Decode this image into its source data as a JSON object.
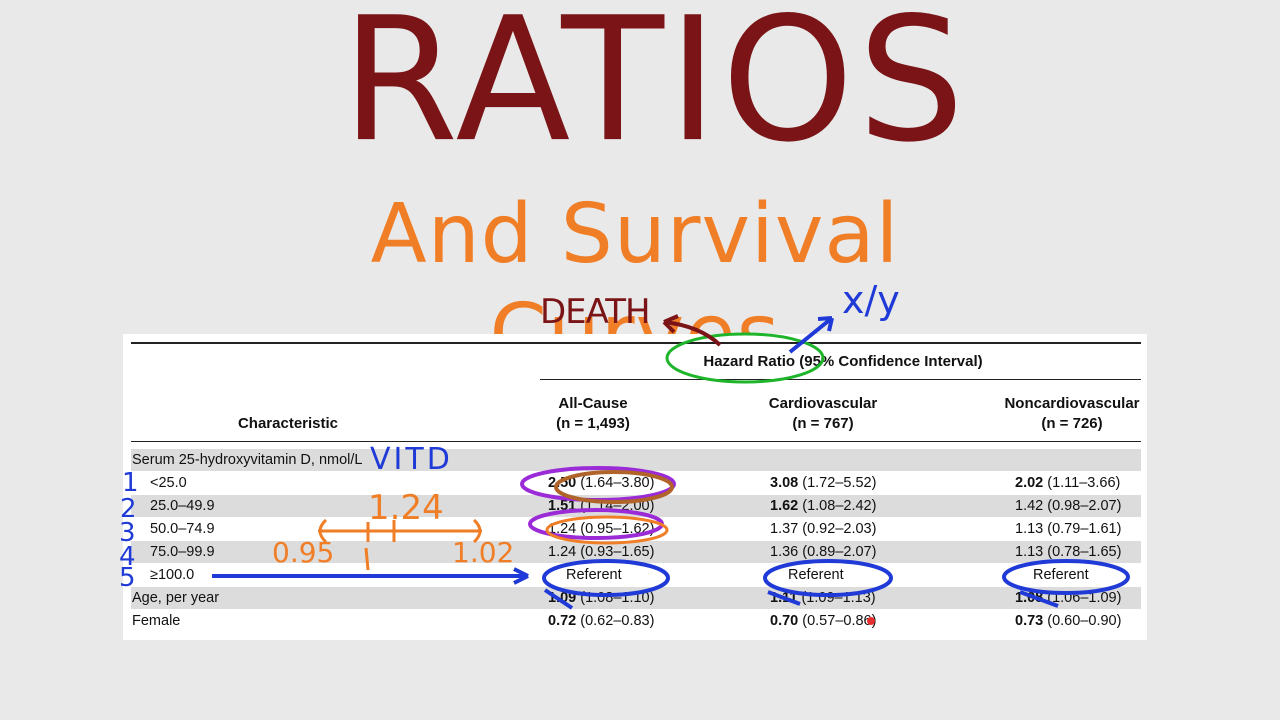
{
  "slide": {
    "title": "RATIOS",
    "subtitle": "And Survival Curves"
  },
  "annotations": {
    "death": "DEATH",
    "xy": "x/y",
    "vitd": "VITD",
    "hr_value": "1.24",
    "ci_low": "0.95",
    "ci_one": "1",
    "ci_high": "1.02",
    "row_numbers": [
      "1",
      "2",
      "3",
      "4",
      "5"
    ]
  },
  "table": {
    "group_header": "Hazard Ratio (95% Confidence Interval)",
    "characteristic_header": "Characteristic",
    "columns": [
      {
        "name": "All-Cause",
        "n": "(n = 1,493)"
      },
      {
        "name": "Cardiovascular",
        "n": "(n = 767)"
      },
      {
        "name": "Noncardiovascular",
        "n": "(n = 726)"
      }
    ],
    "section_label": "Serum 25-hydroxyvitamin D, nmol/L",
    "rows": [
      {
        "label": "<25.0",
        "cells": [
          {
            "hr": "2.50",
            "ci": "(1.64–3.80)",
            "bold": true
          },
          {
            "hr": "3.08",
            "ci": "(1.72–5.52)",
            "bold": true
          },
          {
            "hr": "2.02",
            "ci": "(1.11–3.66)",
            "bold": true
          }
        ]
      },
      {
        "label": "25.0–49.9",
        "cells": [
          {
            "hr": "1.51",
            "ci": "(1.14–2.00)",
            "bold": true
          },
          {
            "hr": "1.62",
            "ci": "(1.08–2.42)",
            "bold": true
          },
          {
            "hr": "1.42",
            "ci": "(0.98–2.07)",
            "bold": false
          }
        ]
      },
      {
        "label": "50.0–74.9",
        "cells": [
          {
            "hr": "1.24",
            "ci": "(0.95–1.62)",
            "bold": false
          },
          {
            "hr": "1.37",
            "ci": "(0.92–2.03)",
            "bold": false
          },
          {
            "hr": "1.13",
            "ci": "(0.79–1.61)",
            "bold": false
          }
        ]
      },
      {
        "label": "75.0–99.9",
        "cells": [
          {
            "hr": "1.24",
            "ci": "(0.93–1.65)",
            "bold": false
          },
          {
            "hr": "1.36",
            "ci": "(0.89–2.07)",
            "bold": false
          },
          {
            "hr": "1.13",
            "ci": "(0.78–1.65)",
            "bold": false
          }
        ]
      },
      {
        "label": "≥100.0",
        "referent": "Referent"
      },
      {
        "label": "Age, per year",
        "cells": [
          {
            "hr": "1.09",
            "ci": "(1.08–1.10)",
            "bold": true
          },
          {
            "hr": "1.11",
            "ci": "(1.09–1.13)",
            "bold": true
          },
          {
            "hr": "1.08",
            "ci": "(1.06–1.09)",
            "bold": true
          }
        ]
      },
      {
        "label": "Female",
        "cells": [
          {
            "hr": "0.72",
            "ci": "(0.62–0.83)",
            "bold": true
          },
          {
            "hr": "0.70",
            "ci": "(0.57–0.86)",
            "bold": true
          },
          {
            "hr": "0.73",
            "ci": "(0.60–0.90)",
            "bold": true
          }
        ]
      }
    ]
  },
  "colors": {
    "title": "#7a1416",
    "subtitle": "#f07e26",
    "pen_blue": "#1f3ad6",
    "pen_green": "#1fb52b",
    "pen_purple": "#9b2bd6",
    "pen_brown": "#b0642a"
  }
}
